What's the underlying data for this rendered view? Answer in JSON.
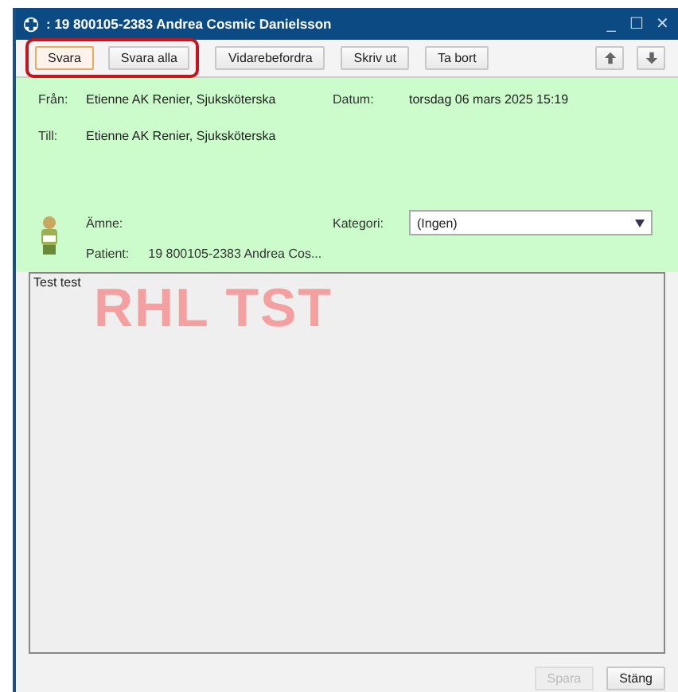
{
  "window": {
    "title": ": 19 800105-2383 Andrea Cosmic Danielsson",
    "controls": [
      "_",
      "☐",
      "✕"
    ]
  },
  "toolbar": {
    "buttons": [
      {
        "label": "Svara",
        "selected": true,
        "highlighted": true
      },
      {
        "label": "Svara alla",
        "selected": false,
        "highlighted": true
      },
      {
        "label": "Vidarebefordra",
        "selected": false,
        "highlighted": false
      },
      {
        "label": "Skriv ut",
        "selected": false,
        "highlighted": false
      },
      {
        "label": "Ta bort",
        "selected": false,
        "highlighted": false
      }
    ]
  },
  "header": {
    "from_label": "Från:",
    "from": "Etienne AK Renier, Sjuksköterska",
    "date_label": "Datum:",
    "date": "torsdag 06 mars 2025 15:19",
    "to_label": "Till:",
    "to": "Etienne AK Renier, Sjuksköterska",
    "subject_label": "Ämne:",
    "category_label": "Kategori:",
    "category": "(Ingen)",
    "patient_label": "Patient:",
    "patient": "19 800105-2383 Andrea Cos..."
  },
  "message": {
    "body": "Test test",
    "stamp": "RHL TST"
  },
  "footer": {
    "buttons": [
      {
        "label": "Spara",
        "disabled": true
      },
      {
        "label": "Stäng",
        "disabled": false
      }
    ]
  }
}
